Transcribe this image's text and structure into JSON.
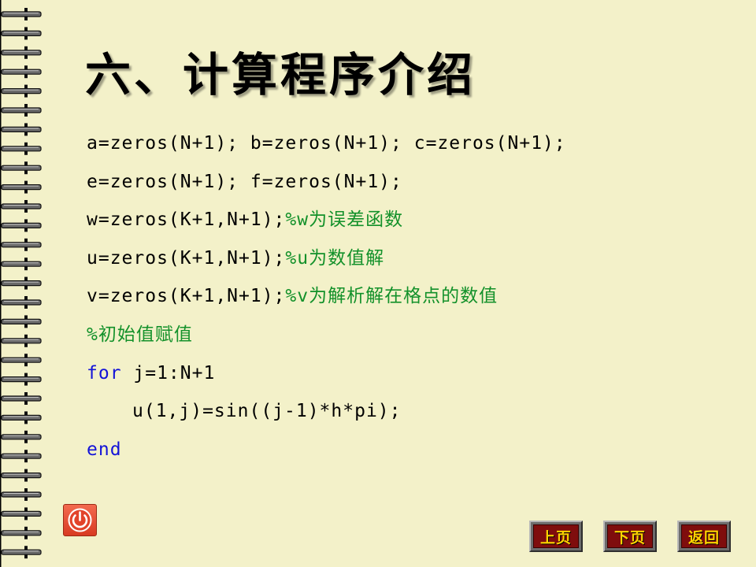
{
  "slide": {
    "title": "六、计算程序介绍",
    "code_lines": [
      [
        {
          "text": "a=zeros(N+1); b=zeros(N+1); c=zeros(N+1);",
          "kind": "code"
        }
      ],
      [
        {
          "text": "e=zeros(N+1); f=zeros(N+1);",
          "kind": "code"
        }
      ],
      [
        {
          "text": "w=zeros(K+1,N+1);",
          "kind": "code"
        },
        {
          "text": "%w为误差函数",
          "kind": "comment"
        }
      ],
      [
        {
          "text": "u=zeros(K+1,N+1);",
          "kind": "code"
        },
        {
          "text": "%u为数值解",
          "kind": "comment"
        }
      ],
      [
        {
          "text": "v=zeros(K+1,N+1);",
          "kind": "code"
        },
        {
          "text": "%v为解析解在格点的数值",
          "kind": "comment"
        }
      ],
      [
        {
          "text": "%初始值赋值",
          "kind": "comment"
        }
      ],
      [
        {
          "text": "for",
          "kind": "keyword"
        },
        {
          "text": " j=1:N+1",
          "kind": "code"
        }
      ],
      [
        {
          "text": "",
          "kind": "indent"
        },
        {
          "text": "u(1,j)=sin((j-1)*h*pi);",
          "kind": "code"
        }
      ],
      [
        {
          "text": "end",
          "kind": "keyword"
        }
      ]
    ]
  },
  "nav": {
    "prev_label": "上页",
    "next_label": "下页",
    "back_label": "返回"
  },
  "icons": {
    "power": "power-icon",
    "binding": "spiral-binding"
  },
  "colors": {
    "background": "#f3f1c9",
    "keyword": "#1414d8",
    "comment": "#13912a",
    "nav_face": "#7f0d0d",
    "nav_text": "#ffd400"
  }
}
